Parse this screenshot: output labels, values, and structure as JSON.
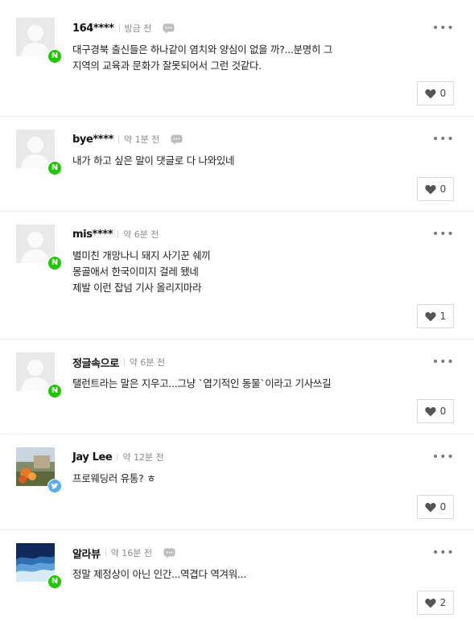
{
  "comments": [
    {
      "author": "164****",
      "time": "방금 전",
      "badge": "N",
      "badge_icon": "naver-icon",
      "reply_icon": true,
      "text": "대구경북 출신들은 하나같이 염치와 양심이 없을 까?...분명히 그\n지역의 교육과 문화가 잘못되어서 그런 것같다.",
      "likes": "0"
    },
    {
      "author": "bye****",
      "time": "약 1분 전",
      "badge": "N",
      "badge_icon": "naver-icon",
      "reply_icon": true,
      "text": "내가 하고 싶은 말이 댓글로 다 나와있네",
      "likes": "0"
    },
    {
      "author": "mis****",
      "time": "약 6분 전",
      "badge": "N",
      "badge_icon": "naver-icon",
      "reply_icon": false,
      "text": "별미친 개망나니 돼지 사기꾼 쉐끼\n몽골애서 한국이미지 걸레 됐네\n제발 이런 잡넘 기사 올리지마라",
      "likes": "1"
    },
    {
      "author": "정글속으로",
      "time": "약 6분 전",
      "badge": "N",
      "badge_icon": "naver-icon",
      "reply_icon": false,
      "text": "탤런트라는 말은 지우고...그냥 `엽기적인 동물`이라고 기사쓰길",
      "likes": "0"
    },
    {
      "author": "Jay Lee",
      "time": "약 12분 전",
      "badge": "",
      "badge_icon": "twitter-icon",
      "reply_icon": false,
      "text": "프로웨딩러 유통? ㅎ",
      "likes": "0"
    },
    {
      "author": "알라뷰",
      "time": "약 16분 전",
      "badge": "N",
      "badge_icon": "naver-icon",
      "reply_icon": true,
      "text": "정말 제정상이 아닌 인간...역겹다 역겨워...",
      "likes": "2"
    }
  ],
  "more_label": "•••",
  "colors": {
    "naver": "#1ec800",
    "twitter": "#55acee"
  }
}
